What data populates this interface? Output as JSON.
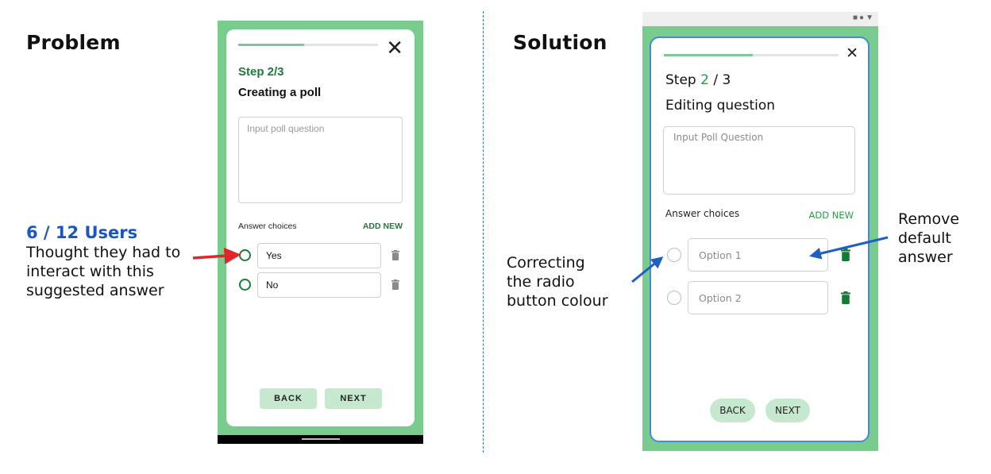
{
  "problem": {
    "heading": "Problem",
    "stat": "6 / 12 Users",
    "note_lines": [
      "Thought they had to",
      "interact with this",
      "suggested answer"
    ],
    "phone": {
      "step": "Step 2/3",
      "title": "Creating a poll",
      "progress": 0.47,
      "question_placeholder": "Input poll question",
      "answer_choices_label": "Answer choices",
      "add_new_label": "ADD NEW",
      "options": [
        "Yes",
        "No"
      ],
      "back_label": "BACK",
      "next_label": "NEXT"
    }
  },
  "solution": {
    "heading": "Solution",
    "left_note_lines": [
      "Correcting",
      "the radio",
      "button colour"
    ],
    "right_note_lines": [
      "Remove",
      "default",
      "answer"
    ],
    "phone": {
      "step_prefix": "Step ",
      "step_current": "2",
      "step_suffix": " / 3",
      "title": "Editing question",
      "progress": 0.51,
      "question_placeholder": "Input Poll Question",
      "answer_choices_label": "Answer choices",
      "add_new_label": "ADD NEW",
      "options": [
        "Option 1",
        "Option 2"
      ],
      "back_label": "BACK",
      "next_label": "NEXT"
    }
  },
  "colors": {
    "green_dark": "#1f7a3a",
    "green_frame": "#7acb8e",
    "button_bg": "#c5e8cf",
    "stat_blue": "#1b55c0",
    "arrow_red": "#e0262b",
    "arrow_blue": "#1f5fc4"
  }
}
